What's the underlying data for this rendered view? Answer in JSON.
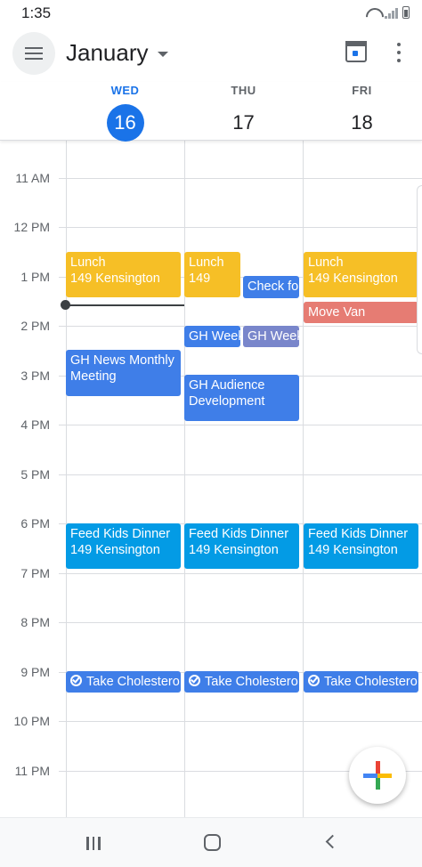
{
  "status_bar": {
    "time": "1:35"
  },
  "app_bar": {
    "month": "January"
  },
  "days": [
    {
      "dow": "WED",
      "date": "16",
      "today": true
    },
    {
      "dow": "THU",
      "date": "17",
      "today": false
    },
    {
      "dow": "FRI",
      "date": "18",
      "today": false
    }
  ],
  "hours": [
    "11 AM",
    "12 PM",
    "1 PM",
    "2 PM",
    "3 PM",
    "4 PM",
    "5 PM",
    "6 PM",
    "7 PM",
    "8 PM",
    "9 PM",
    "10 PM",
    "11 PM"
  ],
  "events": [
    {
      "id": "lunch-wed",
      "title": "Lunch",
      "location": "149 Kensington",
      "color": "#f6bf26"
    },
    {
      "id": "lunch-thu",
      "title": "Lunch",
      "location": "149",
      "color": "#f6bf26"
    },
    {
      "id": "check-thu",
      "title": "Check fo",
      "color": "#3f7ee8"
    },
    {
      "id": "lunch-fri",
      "title": "Lunch",
      "location": "149 Kensington",
      "color": "#f6bf26"
    },
    {
      "id": "movevan-fri",
      "title": "Move Van",
      "color": "#e67c73"
    },
    {
      "id": "ghweek1-thu",
      "title": "GH Week",
      "color": "#3f7ee8"
    },
    {
      "id": "ghweek2-thu",
      "title": "GH Week",
      "color": "#7986cb"
    },
    {
      "id": "ghnews-wed",
      "title": "GH News Monthly Meeting",
      "color": "#3f7ee8"
    },
    {
      "id": "ghaud-thu",
      "title": "GH Audience Development",
      "color": "#3f7ee8"
    },
    {
      "id": "feed-wed",
      "title": "Feed Kids Dinner",
      "location": "149 Kensington",
      "color": "#039be5"
    },
    {
      "id": "feed-thu",
      "title": "Feed Kids Dinner",
      "location": "149 Kensington",
      "color": "#039be5"
    },
    {
      "id": "feed-fri",
      "title": "Feed Kids Dinner",
      "location": "149 Kensington",
      "color": "#039be5"
    },
    {
      "id": "chol-wed",
      "title": "Take Cholestero",
      "color": "#3f7ee8"
    },
    {
      "id": "chol-thu",
      "title": "Take Cholestero",
      "color": "#3f7ee8"
    },
    {
      "id": "chol-fri",
      "title": "Take Cholestero",
      "color": "#3f7ee8"
    }
  ]
}
